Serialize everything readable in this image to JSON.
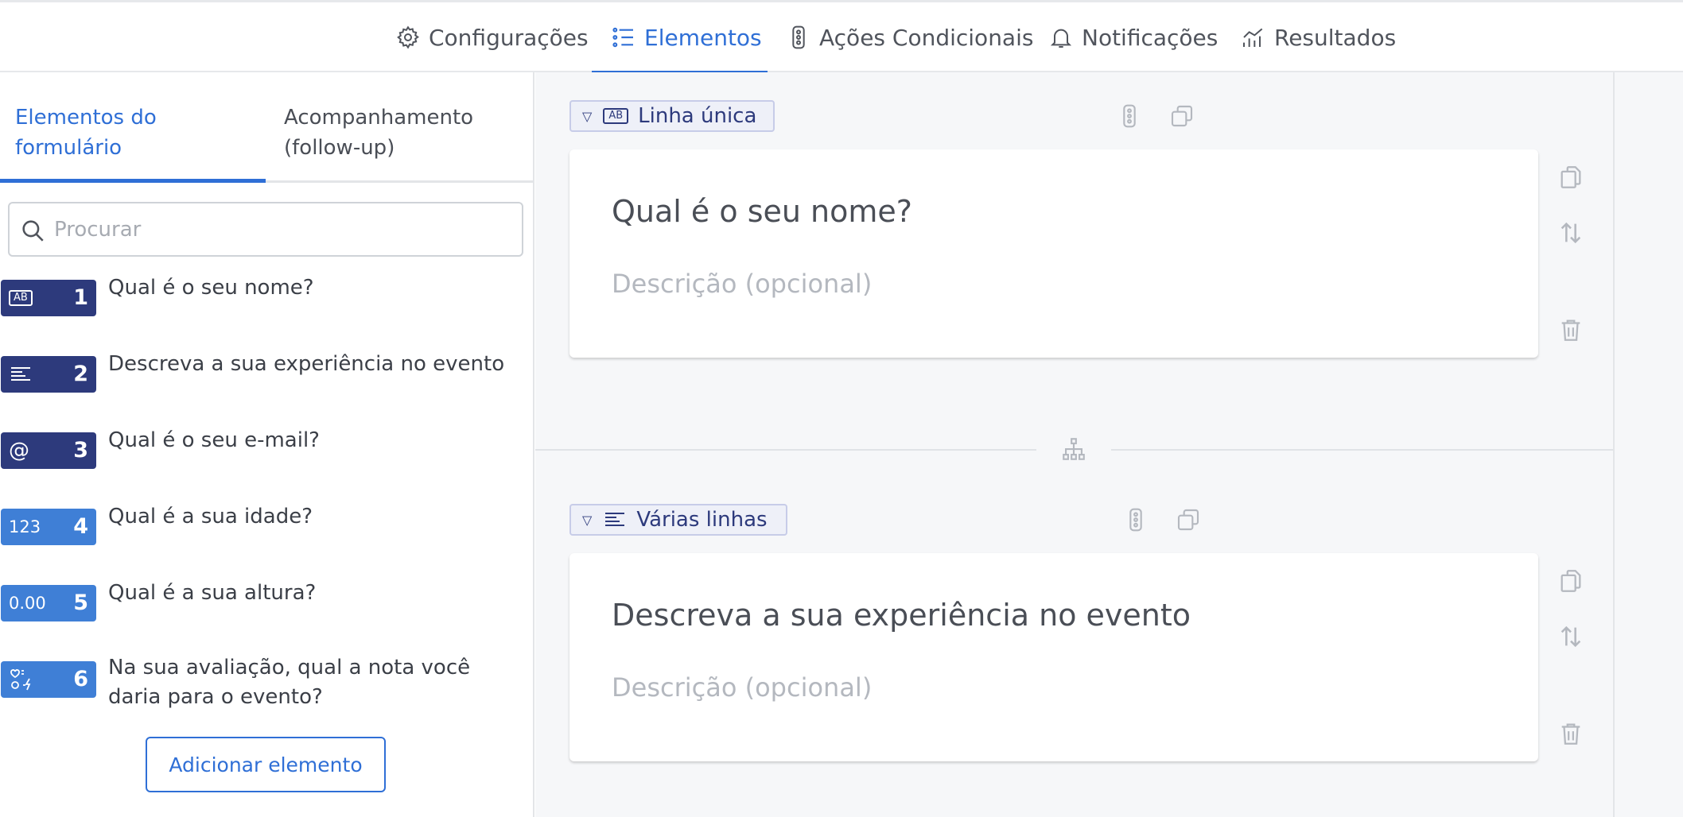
{
  "nav": {
    "tabs": [
      {
        "label": "Configurações",
        "icon": "gear-icon"
      },
      {
        "label": "Elementos",
        "icon": "list-icon",
        "active": true
      },
      {
        "label": "Ações Condicionais",
        "icon": "traffic-light-icon"
      },
      {
        "label": "Notificações",
        "icon": "bell-icon"
      },
      {
        "label": "Resultados",
        "icon": "chart-icon"
      }
    ]
  },
  "sidebar": {
    "tab_elements": "Elementos do formulário",
    "tab_followup": "Acompanhamento (follow-up)",
    "search_placeholder": "Procurar",
    "items": [
      {
        "num": "1",
        "icon_text": "AB",
        "icon": "text-ab-icon",
        "label": "Qual é o seu nome?"
      },
      {
        "num": "2",
        "icon_text": "",
        "icon": "lines-icon",
        "label": "Descreva a sua experiência no evento"
      },
      {
        "num": "3",
        "icon_text": "@",
        "icon": "at-icon",
        "label": "Qual é o seu e-mail?"
      },
      {
        "num": "4",
        "icon_text": "123",
        "icon": "number-icon",
        "label": "Qual é a sua idade?"
      },
      {
        "num": "5",
        "icon_text": "0.00",
        "icon": "decimal-icon",
        "label": "Qual é a sua altura?"
      },
      {
        "num": "6",
        "icon_text": "",
        "icon": "rating-icon",
        "label": "Na sua avaliação, qual a nota você daria para o evento?"
      }
    ],
    "add_button": "Adicionar elemento"
  },
  "main": {
    "elements": [
      {
        "type": "Linha única",
        "title": "Qual é o seu nome?",
        "description_placeholder": "Descrição (opcional)"
      },
      {
        "type": "Várias linhas",
        "title": "Descreva a sua experiência no evento",
        "description_placeholder": "Descrição (opcional)"
      }
    ]
  },
  "colors": {
    "accent": "#2f6fd6",
    "badge_dark": "#2d3a7c",
    "badge_light": "#3f7fd6"
  }
}
